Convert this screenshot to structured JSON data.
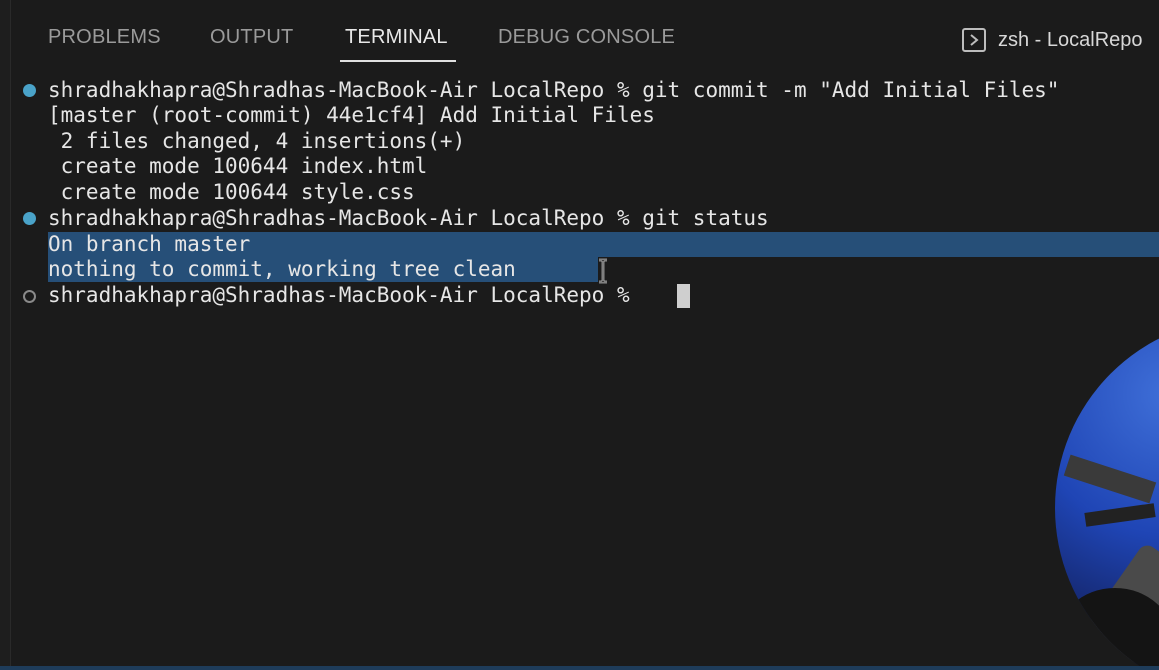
{
  "tabs": {
    "problems": "PROBLEMS",
    "output": "OUTPUT",
    "terminal": "TERMINAL",
    "debug_console": "DEBUG CONSOLE",
    "active": "TERMINAL"
  },
  "terminal_switcher": {
    "icon": "terminal-icon",
    "label": "zsh - LocalRepo"
  },
  "terminal": {
    "lines": [
      "shradhakhapra@Shradhas-MacBook-Air LocalRepo % git commit -m \"Add Initial Files\"",
      "[master (root-commit) 44e1cf4] Add Initial Files",
      " 2 files changed, 4 insertions(+)",
      " create mode 100644 index.html",
      " create mode 100644 style.css",
      "shradhakhapra@Shradhas-MacBook-Air LocalRepo % git status",
      "On branch master",
      "nothing to commit, working tree clean",
      "shradhakhapra@Shradhas-MacBook-Air LocalRepo % "
    ]
  },
  "colors": {
    "background": "#1b1b1b",
    "selection": "#264f78",
    "success_dot": "#4aa3c9",
    "text": "#e6e6e6"
  }
}
